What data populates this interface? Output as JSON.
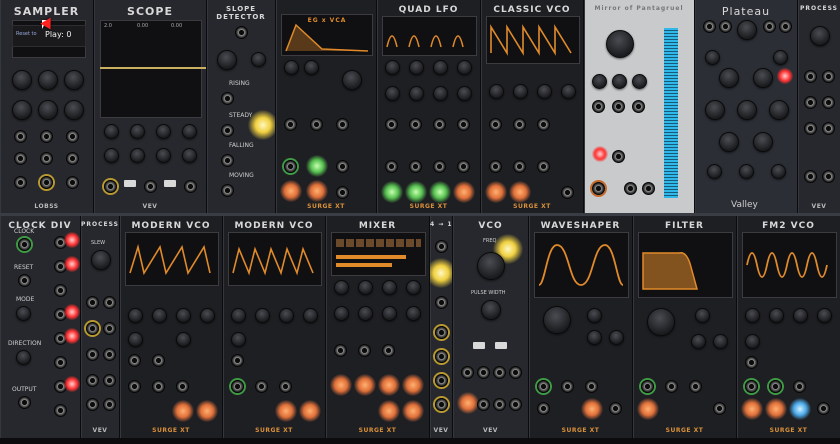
{
  "row1": {
    "sampler": {
      "title": "SAMPLER",
      "brand": "LOBSS",
      "readout": "Reset to",
      "status": "Play: 0"
    },
    "scope": {
      "title": "SCOPE",
      "brand": "VEV",
      "readout_left": "2.0",
      "readout_center": "0.00",
      "readout_right": "0.00"
    },
    "slope_detector": {
      "title": "SLOPE DETECTOR",
      "labels": [
        "RISING",
        "STEADY",
        "FALLING",
        "MOVING"
      ]
    },
    "eg_vca": {
      "title": "EG x VCA",
      "brand": "SURGE XT"
    },
    "quad_lfo": {
      "title": "QUAD LFO",
      "brand": "SURGE XT"
    },
    "classic_vco": {
      "title": "CLASSIC VCO",
      "brand": "SURGE XT"
    },
    "mirror": {
      "title": "Mirror of Pantagruel"
    },
    "plateau": {
      "title": "Plateau",
      "footer": "Valley"
    },
    "process": {
      "title": "PROCESS",
      "brand": "VEV"
    }
  },
  "row2": {
    "clock_div": {
      "title": "CLOCK DIV",
      "labels": [
        "CLOCK",
        "RESET",
        "MODE",
        "DIRECTION",
        "OUTPUT"
      ]
    },
    "process": {
      "title": "PROCESS",
      "brand": "VEV",
      "knob_label": "SLEW"
    },
    "modern_vco_1": {
      "title": "MODERN VCO",
      "brand": "SURGE XT"
    },
    "modern_vco_2": {
      "title": "MODERN VCO",
      "brand": "SURGE XT"
    },
    "mixer": {
      "title": "MIXER",
      "brand": "SURGE XT"
    },
    "switch": {
      "title": "4 → 1",
      "brand": "VEV"
    },
    "vco": {
      "title": "VCO",
      "brand": "VEV",
      "labels": [
        "FREQ",
        "PULSE WIDTH"
      ]
    },
    "waveshaper": {
      "title": "WAVESHAPER",
      "brand": "SURGE XT"
    },
    "filter": {
      "title": "FILTER",
      "brand": "SURGE XT"
    },
    "fm2_vco": {
      "title": "FM2 VCO",
      "brand": "SURGE XT"
    }
  },
  "colors": {
    "accent": "#e08a2a",
    "led_red": "#ff3030",
    "led_green": "#56c050",
    "vu_blue": "#2fb8e8"
  }
}
